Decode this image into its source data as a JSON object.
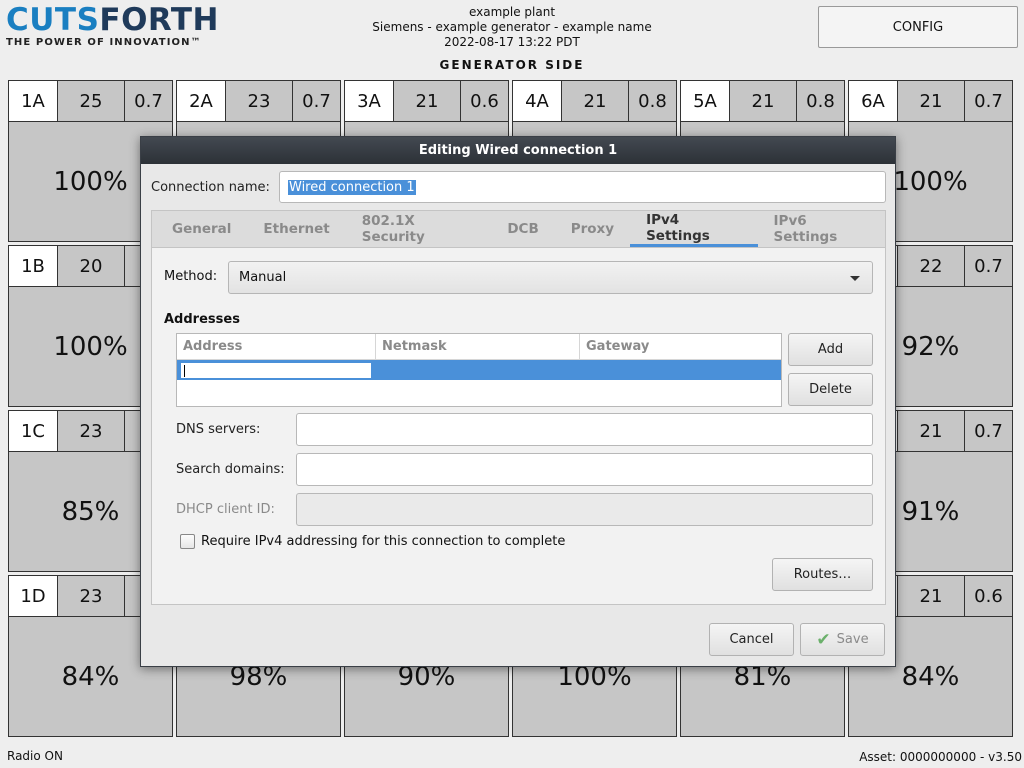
{
  "brand": {
    "name_part1": "CUTS",
    "name_part2": "FORTH",
    "tagline": "THE POWER OF INNOVATION™"
  },
  "header": {
    "plant": "example plant",
    "generator": "Siemens - example generator - example name",
    "datetime": "2022-08-17 13:22 PDT",
    "config_label": "CONFIG",
    "side_title": "GENERATOR SIDE"
  },
  "tiles": {
    "r0": [
      {
        "id": "1A",
        "temp": "25",
        "wear": "0.7",
        "pct": "100%"
      },
      {
        "id": "2A",
        "temp": "23",
        "wear": "0.7",
        "pct": ""
      },
      {
        "id": "3A",
        "temp": "21",
        "wear": "0.6",
        "pct": ""
      },
      {
        "id": "4A",
        "temp": "21",
        "wear": "0.8",
        "pct": ""
      },
      {
        "id": "5A",
        "temp": "21",
        "wear": "0.8",
        "pct": ""
      },
      {
        "id": "6A",
        "temp": "21",
        "wear": "0.7",
        "pct": "100%"
      }
    ],
    "r1": [
      {
        "id": "1B",
        "temp": "20",
        "wear": "",
        "pct": "100%"
      },
      {
        "id": "",
        "temp": "",
        "wear": "",
        "pct": ""
      },
      {
        "id": "",
        "temp": "",
        "wear": "",
        "pct": ""
      },
      {
        "id": "",
        "temp": "",
        "wear": "",
        "pct": ""
      },
      {
        "id": "",
        "temp": "",
        "wear": "",
        "pct": ""
      },
      {
        "id": "",
        "temp": "22",
        "wear": "0.7",
        "pct": "92%"
      }
    ],
    "r2": [
      {
        "id": "1C",
        "temp": "23",
        "wear": "",
        "pct": "85%"
      },
      {
        "id": "",
        "temp": "",
        "wear": "",
        "pct": ""
      },
      {
        "id": "",
        "temp": "",
        "wear": "",
        "pct": ""
      },
      {
        "id": "",
        "temp": "",
        "wear": "",
        "pct": ""
      },
      {
        "id": "",
        "temp": "",
        "wear": "",
        "pct": ""
      },
      {
        "id": "",
        "temp": "21",
        "wear": "0.7",
        "pct": "91%"
      }
    ],
    "r3": [
      {
        "id": "1D",
        "temp": "23",
        "wear": "",
        "pct": "84%"
      },
      {
        "id": "",
        "temp": "",
        "wear": "",
        "pct": "98%"
      },
      {
        "id": "",
        "temp": "",
        "wear": "",
        "pct": "90%"
      },
      {
        "id": "",
        "temp": "",
        "wear": "",
        "pct": "100%"
      },
      {
        "id": "",
        "temp": "",
        "wear": "",
        "pct": "81%"
      },
      {
        "id": "",
        "temp": "21",
        "wear": "0.6",
        "pct": "84%"
      }
    ]
  },
  "footer": {
    "radio": "Radio ON",
    "asset": "Asset: 0000000000 - v3.50"
  },
  "dialog": {
    "title": "Editing Wired connection 1",
    "conn_label": "Connection name:",
    "conn_value": "Wired connection 1",
    "tabs": [
      "General",
      "Ethernet",
      "802.1X Security",
      "DCB",
      "Proxy",
      "IPv4 Settings",
      "IPv6 Settings"
    ],
    "active_tab": "IPv4 Settings",
    "method_label": "Method:",
    "method_value": "Manual",
    "addresses_title": "Addresses",
    "columns": [
      "Address",
      "Netmask",
      "Gateway"
    ],
    "add_label": "Add",
    "delete_label": "Delete",
    "dns_label": "DNS servers:",
    "search_label": "Search domains:",
    "dhcp_label": "DHCP client ID:",
    "require_label": "Require IPv4 addressing for this connection to complete",
    "require_checked": false,
    "routes_label": "Routes…",
    "cancel_label": "Cancel",
    "save_label": "Save"
  },
  "colors": {
    "accent": "#4a90d9",
    "brand_blue": "#1a7fc1",
    "brand_navy": "#1f3a5a",
    "tile_bg": "#c6c6c6"
  },
  "icons": {
    "save": "check-icon",
    "combo": "chevron-down-icon"
  }
}
